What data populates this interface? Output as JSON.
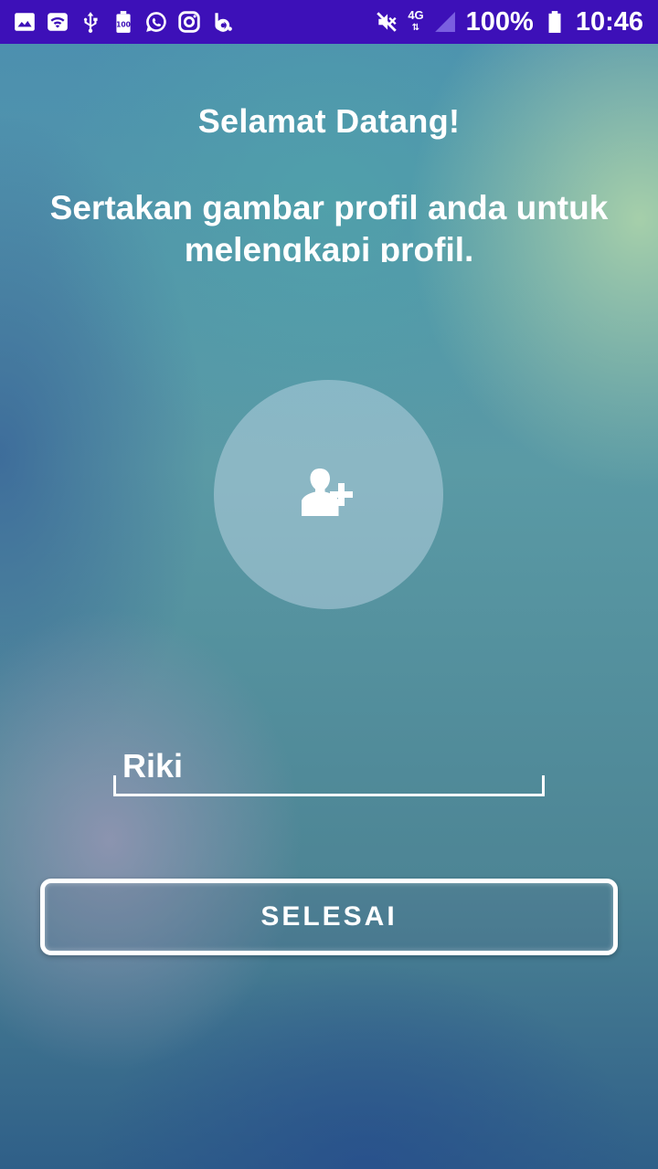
{
  "status_bar": {
    "left_icons": [
      "gallery-icon",
      "wifi-icon",
      "usb-icon",
      "battery-100-icon",
      "whatsapp-icon",
      "instagram-icon",
      "beats-icon"
    ],
    "right_icons": [
      "mute-icon",
      "signal-icon",
      "battery-icon"
    ],
    "network": "4G",
    "battery": "100%",
    "time": "10:46",
    "background_color": "#3d10b8"
  },
  "welcome": "Selamat Datang!",
  "instruction": "Sertakan gambar profil anda untuk melengkapi profil.",
  "avatar": {
    "icon": "add-user-icon"
  },
  "name_field": {
    "value": "Riki"
  },
  "submit_button": {
    "label": "SELESAI"
  }
}
